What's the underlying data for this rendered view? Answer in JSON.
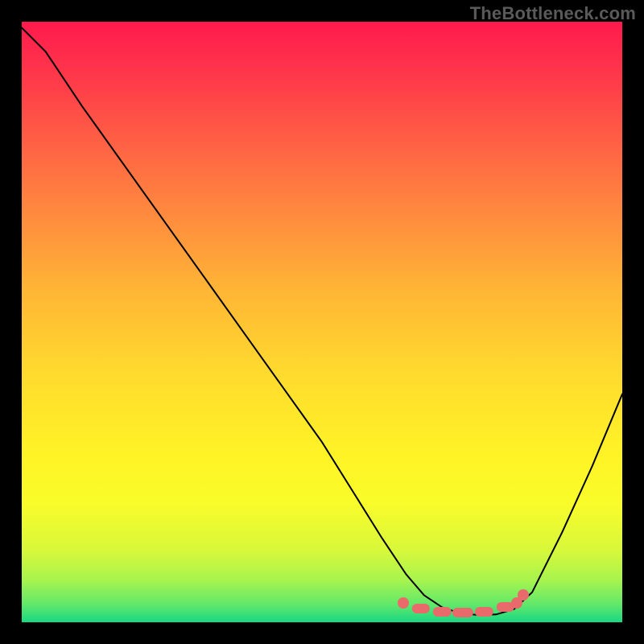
{
  "attribution": "TheBottleneck.com",
  "colors": {
    "dot": "#e86a6a",
    "curve": "#000000"
  },
  "chart_data": {
    "type": "line",
    "title": "",
    "xlabel": "",
    "ylabel": "",
    "xlim": [
      0,
      100
    ],
    "ylim": [
      0,
      100
    ],
    "grid": false,
    "series": [
      {
        "name": "bottleneck-curve",
        "x": [
          0,
          4,
          10,
          20,
          30,
          40,
          50,
          55,
          60,
          64,
          67,
          70,
          73,
          76,
          79,
          82,
          85,
          90,
          95,
          100
        ],
        "y": [
          99,
          95,
          86,
          72,
          58,
          44,
          30,
          22,
          14,
          8,
          4.5,
          2.5,
          1.5,
          1.2,
          1.3,
          2.2,
          5,
          15,
          26,
          38
        ]
      }
    ],
    "markers": [
      {
        "x": 63.5,
        "y": 3.2,
        "shape": "dot"
      },
      {
        "x": 66.5,
        "y": 2.3,
        "shape": "dash",
        "len": 3
      },
      {
        "x": 70.0,
        "y": 1.8,
        "shape": "dash",
        "len": 3
      },
      {
        "x": 73.5,
        "y": 1.6,
        "shape": "dash",
        "len": 3.5
      },
      {
        "x": 77.0,
        "y": 1.7,
        "shape": "dash",
        "len": 3
      },
      {
        "x": 80.5,
        "y": 2.5,
        "shape": "dash",
        "len": 3
      },
      {
        "x": 82.5,
        "y": 3.2,
        "shape": "dot"
      },
      {
        "x": 83.5,
        "y": 4.5,
        "shape": "dot"
      }
    ]
  }
}
